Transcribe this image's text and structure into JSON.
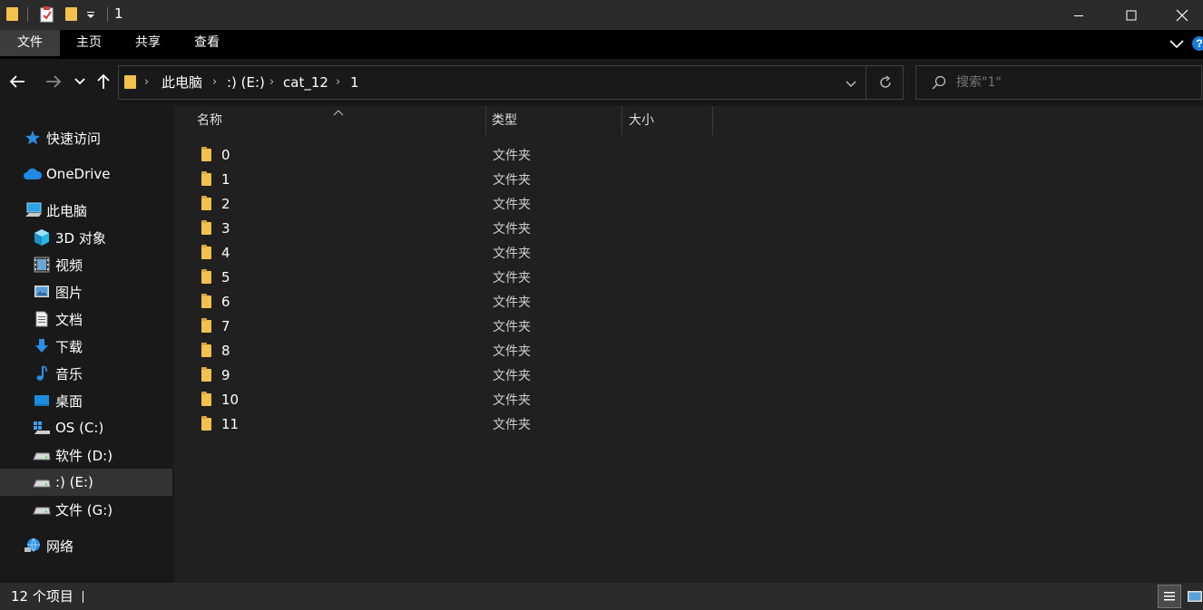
{
  "window": {
    "title": "1",
    "qat_dropdown_icon": "caret-down-icon"
  },
  "ribbon": {
    "tabs": [
      {
        "label": "文件",
        "active": true
      },
      {
        "label": "主页",
        "active": false
      },
      {
        "label": "共享",
        "active": false
      },
      {
        "label": "查看",
        "active": false
      }
    ]
  },
  "address": {
    "crumbs": [
      "此电脑",
      ":) (E:)",
      "cat_12",
      "1"
    ]
  },
  "search": {
    "placeholder": "搜索\"1\""
  },
  "sidebar": {
    "items": [
      {
        "label": "快速访问",
        "icon": "star-icon"
      },
      {
        "label": "OneDrive",
        "icon": "cloud-icon"
      },
      {
        "label": "此电脑",
        "icon": "computer-icon"
      },
      {
        "label": "3D 对象",
        "icon": "cube-icon"
      },
      {
        "label": "视频",
        "icon": "video-icon"
      },
      {
        "label": "图片",
        "icon": "picture-icon"
      },
      {
        "label": "文档",
        "icon": "document-icon"
      },
      {
        "label": "下载",
        "icon": "download-icon"
      },
      {
        "label": "音乐",
        "icon": "music-icon"
      },
      {
        "label": "桌面",
        "icon": "desktop-icon"
      },
      {
        "label": "OS (C:)",
        "icon": "windows-drive-icon"
      },
      {
        "label": "软件 (D:)",
        "icon": "drive-icon"
      },
      {
        "label": ":) (E:)",
        "icon": "drive-icon",
        "selected": true
      },
      {
        "label": "文件 (G:)",
        "icon": "drive-icon"
      },
      {
        "label": "网络",
        "icon": "network-icon"
      }
    ]
  },
  "columns": {
    "name": "名称",
    "type": "类型",
    "size": "大小"
  },
  "files": [
    {
      "name": "0",
      "type": "文件夹"
    },
    {
      "name": "1",
      "type": "文件夹"
    },
    {
      "name": "2",
      "type": "文件夹"
    },
    {
      "name": "3",
      "type": "文件夹"
    },
    {
      "name": "4",
      "type": "文件夹"
    },
    {
      "name": "5",
      "type": "文件夹"
    },
    {
      "name": "6",
      "type": "文件夹"
    },
    {
      "name": "7",
      "type": "文件夹"
    },
    {
      "name": "8",
      "type": "文件夹"
    },
    {
      "name": "9",
      "type": "文件夹"
    },
    {
      "name": "10",
      "type": "文件夹"
    },
    {
      "name": "11",
      "type": "文件夹"
    }
  ],
  "status": {
    "item_count": "12 个项目"
  },
  "colors": {
    "folder": "#f3c14d",
    "accent": "#0078d7"
  }
}
